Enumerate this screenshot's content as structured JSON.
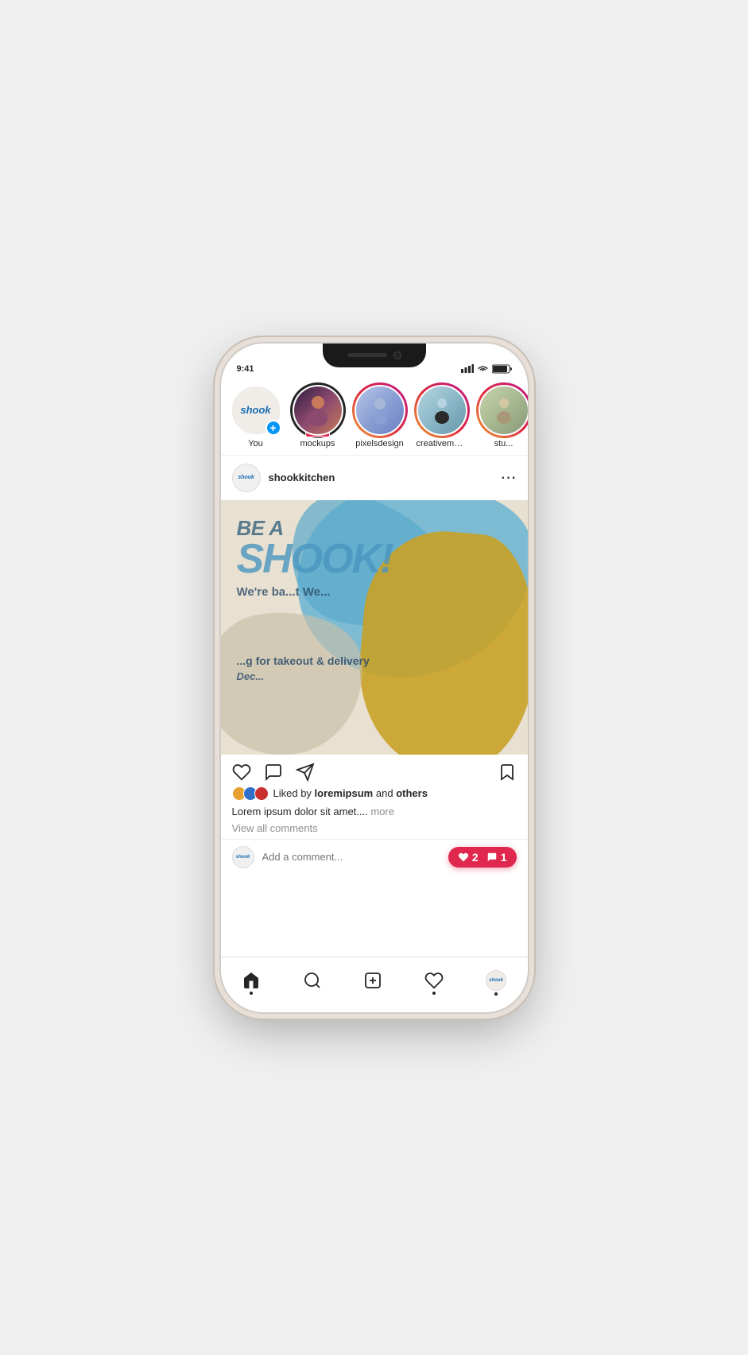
{
  "phone": {
    "stories": [
      {
        "id": "you",
        "label": "You",
        "type": "your-story",
        "hasAdd": true,
        "ringType": "none"
      },
      {
        "id": "mockups",
        "label": "mockups",
        "type": "user",
        "hasLive": true,
        "ringType": "dark"
      },
      {
        "id": "pixelsdesign",
        "label": "pixelsdesign",
        "type": "user",
        "ringType": "gradient"
      },
      {
        "id": "creativemarket",
        "label": "creativemarket",
        "type": "user",
        "ringType": "gradient"
      },
      {
        "id": "studio",
        "label": "stu...",
        "type": "user",
        "ringType": "gradient"
      }
    ],
    "post": {
      "username": "shookkitchen",
      "imageAlt": "Be a SHOOK! We're back this Wednesday for takeout & delivery December",
      "overlayTop": "Be a",
      "overlayMain": "SHOOK!",
      "overlaySub": "We're ba...t We...",
      "overlayBody": "...g for takeout & delivery",
      "overlayDate": "Dec...",
      "likedBy": "loremipsum",
      "likedByOthers": "others",
      "likesPrefix": "Liked by",
      "likesAnd": "and",
      "caption": "Lorem ipsum dolor sit amet....",
      "captionMore": "more",
      "commentsLink": "View all comments",
      "commentPlaceholder": "Add a comment...",
      "notifLikes": "2",
      "notifComments": "1"
    },
    "nav": {
      "items": [
        "home",
        "search",
        "add",
        "heart",
        "profile"
      ]
    }
  }
}
